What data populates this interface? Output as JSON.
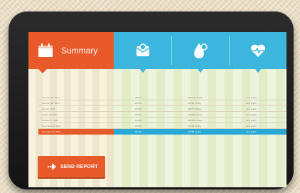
{
  "summary": {
    "title": "Summary"
  },
  "columns": [
    {
      "icon": "envelope-icon"
    },
    {
      "icon": "drop-icon"
    },
    {
      "icon": "heart-pulse-icon"
    }
  ],
  "rows": [
    {
      "date": "February 18, 2013",
      "weight": "200 lbs",
      "pressure": "186/119 mmHg",
      "graph": "view graph"
    },
    {
      "date": "February 28, 2013",
      "weight": "200 lbs",
      "pressure": "185/96 mmHg",
      "graph": "view graph"
    },
    {
      "date": "May 03, 2013",
      "weight": "193 lbs",
      "pressure": "186/77 mmHg",
      "graph": "view graph"
    },
    {
      "date": "August 19, 2013",
      "weight": "198 lbs",
      "pressure": "150/120 mmHg",
      "graph": "view graph"
    },
    {
      "date": "October 17, 2013",
      "weight": "194 lbs",
      "pressure": "186/119 mmHg",
      "graph": "view graph"
    },
    {
      "date": "November 01, 2013",
      "weight": "190 lbs",
      "pressure": "131/99 mmHg",
      "graph": "view graph"
    },
    {
      "date": "November 22, 2013",
      "weight": "183 lbs",
      "pressure": "120/88 mmHg",
      "graph": "view graph"
    }
  ],
  "send_button": {
    "label": "SEND REPORT"
  },
  "colors": {
    "orange": "#e85a2a",
    "blue": "#3cb6dd",
    "highlight_blue": "#28a9d5"
  }
}
